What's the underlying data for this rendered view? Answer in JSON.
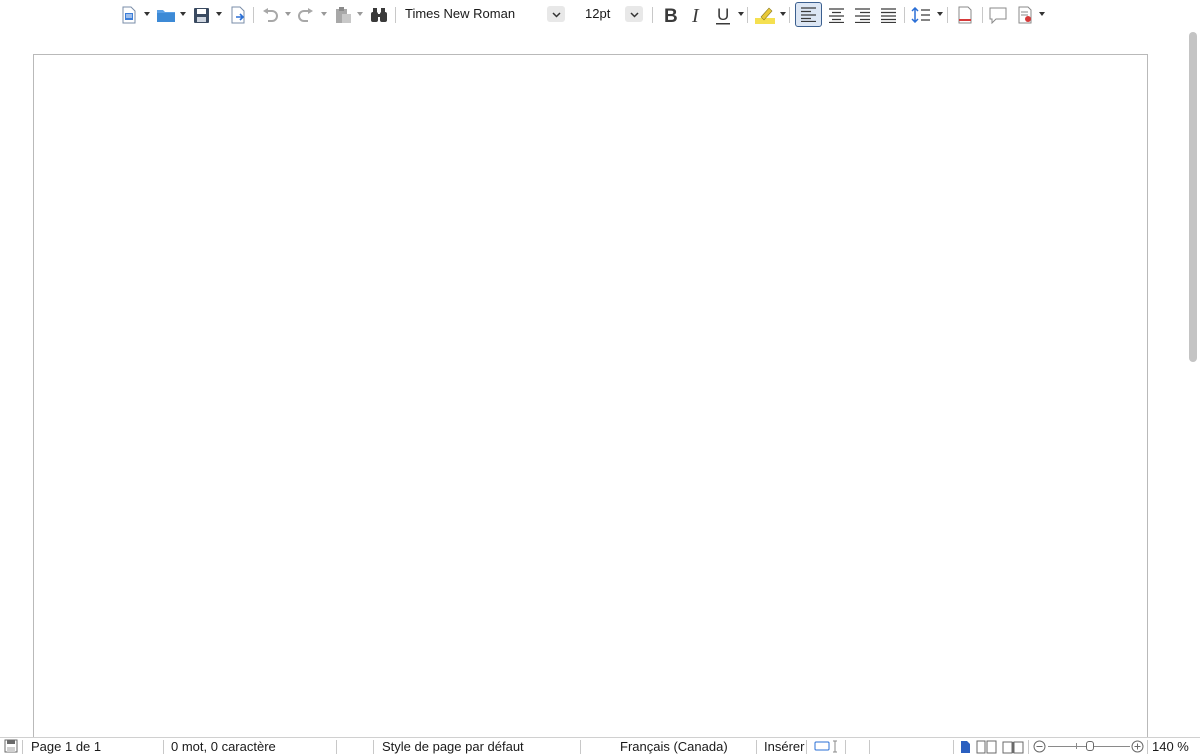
{
  "toolbar": {
    "font_name": "Times New Roman",
    "font_size": "12pt",
    "buttons": [
      "new-document",
      "open",
      "save",
      "export-pdf",
      "undo",
      "redo",
      "paste",
      "find-replace",
      "bold",
      "italic",
      "underline",
      "highlight",
      "align-left",
      "align-center",
      "align-right",
      "justify",
      "line-spacing",
      "page-break",
      "comment",
      "track-changes"
    ]
  },
  "statusbar": {
    "page": "Page 1 de 1",
    "word_count": "0 mot, 0 caractère",
    "page_style": "Style de page par défaut",
    "language": "Français (Canada)",
    "insert_mode": "Insérer",
    "zoom": "140 %"
  },
  "colors": {
    "accent": "#2a6fd6",
    "active_button": "#dce6f4",
    "highlight": "#f5e050"
  }
}
